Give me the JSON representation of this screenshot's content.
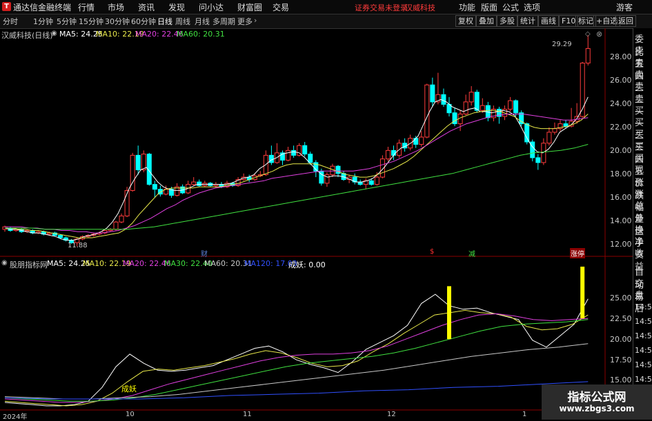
{
  "titlebar": {
    "app_title": "通达信金融终端",
    "menus": [
      "行情",
      "市场",
      "资讯",
      "发现",
      "问小达",
      "财富圈",
      "交易"
    ],
    "login_status": "证券交易未登录",
    "stock": "汉威科技",
    "right_menus": [
      "功能",
      "版面",
      "公式",
      "选项"
    ],
    "guest": "游客"
  },
  "toolbar": {
    "periods": [
      "分时",
      "1分钟",
      "5分钟",
      "15分钟",
      "30分钟",
      "60分钟",
      "日线",
      "周线",
      "月线",
      "多周期",
      "更多"
    ],
    "active_period": "日线",
    "buttons": [
      "复权",
      "叠加",
      "多股",
      "统计",
      "画线",
      "F10",
      "标记",
      "+自选",
      "返回"
    ]
  },
  "main_chart": {
    "stock_label": "汉威科技(日线)",
    "ma_labels": [
      {
        "text": "MA5: 24.25",
        "color": "#ffffff"
      },
      {
        "text": "MA10: 22.19",
        "color": "#e8e84a"
      },
      {
        "text": "MA20: 22.46",
        "color": "#e040e0"
      },
      {
        "text": "MA60: 20.31",
        "color": "#40e040"
      }
    ],
    "y_ticks": [
      "28.00",
      "26.00",
      "24.00",
      "22.00",
      "20.00",
      "18.00",
      "16.00",
      "14.00",
      "12.00"
    ],
    "y_range": [
      11.3,
      29.7
    ],
    "high_annotation": "29.29",
    "low_annotation": "11.88",
    "events": [
      {
        "label": "财",
        "color": "#5a7fd8"
      },
      {
        "label": "$",
        "color": "#ff3030"
      },
      {
        "label": "减",
        "color": "#40e040"
      },
      {
        "label": "涨停",
        "color": "#ffffff"
      }
    ]
  },
  "indicator": {
    "name": "股朋指标网",
    "labels": [
      {
        "text": "MA5: 24.25",
        "color": "#ffffff"
      },
      {
        "text": "MA10: 22.19",
        "color": "#e8e84a"
      },
      {
        "text": "MA20: 22.46",
        "color": "#e040e0"
      },
      {
        "text": "MA30: 22.40",
        "color": "#40e040"
      },
      {
        "text": "MA60: 20.31",
        "color": "#c8c8c8"
      },
      {
        "text": "MA120: 17.03",
        "color": "#3050ff"
      },
      {
        "text": "成妖: 0.00",
        "color": "#ffffff"
      }
    ],
    "y_ticks": [
      "25.00",
      "22.50",
      "20.00",
      "17.50",
      "15.00"
    ],
    "y_range": [
      14.6,
      26.4
    ],
    "signal_label": "成妖"
  },
  "x_dates": [
    "2024年",
    "10",
    "11",
    "12",
    "1"
  ],
  "side_panel": {
    "items_main": [
      "委比",
      "卖五",
      "卖四",
      "卖三",
      "卖二",
      "卖一",
      "买一",
      "买二",
      "买三",
      "买四",
      "买五",
      "现价",
      "涨跌",
      "涨幅",
      "总量",
      "外盘",
      "换手",
      "净资",
      "收益"
    ],
    "items_lower": [
      "自动",
      "交易",
      "盘后"
    ],
    "times": [
      "14:50",
      "14:50",
      "14:56",
      "14:56",
      "14:57",
      "14:57",
      "14:57"
    ]
  },
  "watermark": {
    "line1": "指标公式网",
    "line2": "www.zbgs3.com"
  },
  "colors": {
    "up": "#ff3c3c",
    "down": "#00ffff",
    "ma60": "#40e040",
    "ma120": "#3050ff",
    "signal": "#ffff00"
  },
  "chart_data": {
    "type": "candlestick",
    "title": "汉威科技(日线)",
    "ylim": [
      11.3,
      29.7
    ],
    "candles": [
      [
        13.3,
        13.5,
        13.6,
        13.1
      ],
      [
        13.4,
        13.2,
        13.5,
        13.1
      ],
      [
        13.2,
        13.3,
        13.4,
        13.1
      ],
      [
        13.3,
        13.1,
        13.4,
        13.0
      ],
      [
        13.1,
        13.2,
        13.3,
        13.0
      ],
      [
        13.2,
        13.0,
        13.3,
        12.9
      ],
      [
        13.0,
        13.1,
        13.2,
        12.9
      ],
      [
        13.1,
        12.9,
        13.2,
        12.8
      ],
      [
        12.9,
        13.0,
        13.1,
        12.8
      ],
      [
        13.0,
        12.8,
        13.1,
        12.7
      ],
      [
        12.8,
        12.6,
        12.9,
        12.5
      ],
      [
        12.6,
        12.4,
        12.7,
        12.3
      ],
      [
        12.4,
        12.2,
        12.5,
        12.1
      ],
      [
        12.2,
        12.5,
        12.6,
        11.9
      ],
      [
        12.5,
        12.7,
        12.8,
        12.4
      ],
      [
        12.7,
        12.8,
        12.9,
        12.6
      ],
      [
        12.8,
        12.9,
        13.0,
        12.7
      ],
      [
        12.9,
        13.0,
        13.1,
        12.8
      ],
      [
        13.0,
        13.2,
        13.3,
        12.9
      ],
      [
        13.2,
        13.3,
        13.4,
        13.1
      ],
      [
        13.3,
        13.9,
        14.0,
        13.2
      ],
      [
        13.9,
        14.4,
        14.6,
        13.8
      ],
      [
        14.4,
        16.5,
        16.8,
        14.3
      ],
      [
        16.5,
        19.4,
        19.6,
        16.4
      ],
      [
        19.4,
        18.2,
        20.2,
        17.8
      ],
      [
        18.2,
        19.5,
        19.8,
        18.0
      ],
      [
        19.5,
        17.0,
        19.6,
        16.9
      ],
      [
        17.0,
        16.6,
        17.3,
        15.9
      ],
      [
        16.6,
        16.2,
        16.9,
        16.0
      ],
      [
        16.2,
        16.6,
        16.9,
        16.1
      ],
      [
        16.6,
        16.1,
        16.8,
        15.9
      ],
      [
        16.1,
        16.8,
        17.1,
        16.0
      ],
      [
        16.8,
        16.3,
        17.0,
        16.2
      ],
      [
        16.3,
        17.0,
        17.3,
        16.2
      ],
      [
        17.0,
        17.2,
        17.6,
        16.9
      ],
      [
        17.2,
        16.9,
        17.4,
        16.8
      ],
      [
        16.9,
        17.1,
        17.3,
        16.8
      ],
      [
        17.1,
        16.9,
        17.2,
        16.8
      ],
      [
        16.9,
        17.0,
        17.2,
        16.7
      ],
      [
        17.0,
        16.8,
        17.2,
        16.7
      ],
      [
        16.8,
        17.1,
        17.3,
        16.7
      ],
      [
        17.1,
        16.9,
        17.2,
        16.8
      ],
      [
        16.9,
        17.4,
        17.6,
        16.8
      ],
      [
        17.4,
        17.6,
        17.9,
        17.3
      ],
      [
        17.6,
        17.4,
        17.8,
        17.2
      ],
      [
        17.4,
        17.7,
        17.9,
        17.3
      ],
      [
        17.7,
        17.8,
        18.1,
        17.6
      ],
      [
        17.8,
        19.4,
        19.8,
        17.7
      ],
      [
        19.4,
        18.8,
        20.2,
        18.6
      ],
      [
        18.8,
        19.6,
        20.4,
        18.7
      ],
      [
        19.6,
        19.0,
        19.8,
        18.6
      ],
      [
        19.0,
        19.8,
        20.1,
        18.9
      ],
      [
        19.8,
        19.4,
        20.2,
        19.2
      ],
      [
        19.4,
        20.2,
        20.4,
        19.3
      ],
      [
        20.2,
        19.5,
        20.5,
        19.3
      ],
      [
        19.5,
        18.8,
        19.7,
        18.6
      ],
      [
        18.8,
        18.1,
        19.0,
        17.6
      ],
      [
        18.1,
        17.1,
        18.3,
        16.9
      ],
      [
        17.1,
        17.8,
        18.0,
        16.8
      ],
      [
        17.8,
        18.5,
        18.7,
        17.6
      ],
      [
        18.5,
        17.9,
        18.6,
        17.6
      ],
      [
        17.9,
        17.4,
        18.1,
        17.3
      ],
      [
        17.4,
        17.6,
        17.8,
        17.1
      ],
      [
        17.6,
        17.2,
        17.9,
        17.0
      ],
      [
        17.2,
        17.0,
        17.4,
        16.9
      ],
      [
        17.0,
        17.3,
        17.5,
        16.6
      ],
      [
        17.3,
        17.0,
        17.5,
        16.9
      ],
      [
        17.0,
        17.6,
        18.0,
        16.9
      ],
      [
        17.6,
        19.1,
        19.4,
        17.5
      ],
      [
        19.1,
        19.8,
        20.1,
        18.9
      ],
      [
        19.8,
        19.4,
        20.2,
        19.0
      ],
      [
        19.4,
        20.4,
        20.7,
        19.2
      ],
      [
        20.4,
        20.0,
        20.8,
        19.7
      ],
      [
        20.0,
        20.8,
        21.1,
        19.8
      ],
      [
        20.8,
        20.3,
        21.0,
        20.0
      ],
      [
        20.3,
        20.9,
        21.4,
        20.1
      ],
      [
        20.9,
        25.2,
        25.3,
        20.8
      ],
      [
        25.2,
        23.8,
        25.8,
        23.4
      ],
      [
        23.8,
        24.4,
        26.2,
        23.6
      ],
      [
        24.4,
        23.6,
        24.9,
        23.4
      ],
      [
        23.6,
        22.9,
        24.2,
        22.6
      ],
      [
        22.9,
        22.0,
        23.3,
        21.8
      ],
      [
        22.0,
        22.8,
        23.1,
        21.4
      ],
      [
        22.8,
        23.8,
        24.4,
        22.7
      ],
      [
        23.8,
        24.6,
        25.1,
        23.5
      ],
      [
        24.6,
        23.1,
        24.8,
        22.9
      ],
      [
        23.1,
        23.5,
        24.1,
        22.9
      ],
      [
        23.5,
        22.5,
        23.8,
        22.2
      ],
      [
        22.5,
        23.2,
        23.5,
        22.2
      ],
      [
        23.2,
        22.6,
        23.4,
        22.0
      ],
      [
        22.6,
        23.2,
        23.5,
        22.3
      ],
      [
        23.2,
        23.9,
        24.2,
        23.0
      ],
      [
        23.9,
        22.9,
        24.0,
        22.6
      ],
      [
        22.9,
        22.0,
        23.1,
        21.8
      ],
      [
        22.0,
        20.5,
        22.1,
        20.3
      ],
      [
        20.5,
        19.2,
        20.7,
        18.9
      ],
      [
        19.2,
        18.8,
        19.5,
        18.2
      ],
      [
        18.8,
        20.4,
        20.8,
        18.6
      ],
      [
        20.4,
        21.3,
        21.7,
        20.2
      ],
      [
        21.3,
        21.6,
        22.1,
        21.1
      ],
      [
        21.6,
        22.0,
        22.3,
        21.4
      ],
      [
        22.0,
        21.8,
        22.3,
        21.6
      ],
      [
        21.8,
        22.2,
        23.3,
        21.7
      ],
      [
        22.2,
        22.6,
        23.7,
        22.0
      ],
      [
        22.6,
        27.0,
        27.1,
        22.5
      ],
      [
        27.0,
        28.2,
        29.3,
        26.8
      ]
    ],
    "ma_series": [
      {
        "name": "MA5",
        "color": "#ffffff",
        "values": [
          13.4,
          13.3,
          13.3,
          13.2,
          13.1,
          13.0,
          13.0,
          12.9,
          12.8,
          12.7,
          12.5,
          12.4,
          12.4,
          12.5,
          12.7,
          12.8,
          12.9,
          13.1,
          13.4,
          13.9,
          14.6,
          15.6,
          16.7,
          17.5,
          18.2,
          18.4,
          17.8,
          17.2,
          16.8,
          16.6,
          16.5,
          16.5,
          16.6,
          16.8,
          17.0,
          17.0,
          17.0,
          17.0,
          17.0,
          17.0,
          17.1,
          17.3,
          17.5,
          17.6,
          17.8,
          18.3,
          18.6,
          19.0,
          19.2,
          19.5,
          19.6,
          19.7,
          19.6,
          19.2,
          18.7,
          18.2,
          17.8,
          17.6,
          17.7,
          17.7,
          17.6,
          17.4,
          17.2,
          17.2,
          17.3,
          17.5,
          17.9,
          18.4,
          19.0,
          19.6,
          20.0,
          20.2,
          20.5,
          21.0,
          22.0,
          23.0,
          23.8,
          24.0,
          23.8,
          23.4,
          23.2,
          23.0,
          23.2,
          23.3,
          23.0,
          23.0,
          22.9,
          23.0,
          23.1,
          23.0,
          22.7,
          21.9,
          21.0,
          20.2,
          19.7,
          19.6,
          19.9,
          20.5,
          21.3,
          21.6,
          21.9,
          22.4,
          23.2,
          24.2
        ]
      },
      {
        "name": "MA10",
        "color": "#e8e84a",
        "values": [
          13.4,
          13.4,
          13.3,
          13.3,
          13.2,
          13.2,
          13.1,
          13.0,
          12.9,
          12.8,
          12.7,
          12.6,
          12.6,
          12.6,
          12.7,
          12.8,
          12.9,
          13.0,
          13.3,
          13.8,
          14.5,
          15.1,
          15.7,
          16.3,
          16.6,
          16.7,
          16.7,
          16.7,
          16.7,
          16.8,
          16.8,
          16.8,
          16.8,
          16.9,
          17.0,
          17.1,
          17.3,
          17.5,
          17.7,
          17.9,
          18.1,
          18.4,
          18.6,
          18.7,
          18.7,
          18.7,
          18.7,
          18.6,
          18.4,
          18.2,
          18.0,
          17.8,
          17.7,
          17.6,
          17.6,
          17.7,
          17.9,
          18.1,
          18.3,
          18.6,
          18.9,
          19.3,
          19.8,
          20.3,
          20.8,
          21.3,
          21.8,
          22.2,
          22.5,
          22.7,
          22.9,
          23.0,
          23.1,
          23.1,
          23.0,
          22.8,
          22.6,
          22.2,
          21.9,
          21.7,
          21.6,
          21.6,
          21.6,
          21.7,
          21.8,
          22.0,
          22.3,
          22.8
        ]
      },
      {
        "name": "MA20",
        "color": "#e040e0",
        "values": [
          13.5,
          13.5,
          13.5,
          13.4,
          13.4,
          13.3,
          13.3,
          13.2,
          13.2,
          13.1,
          13.1,
          13.0,
          13.0,
          13.1,
          13.2,
          13.4,
          13.6,
          13.9,
          14.2,
          14.6,
          15.0,
          15.3,
          15.7,
          16.0,
          16.3,
          16.5,
          16.7,
          16.8,
          16.9,
          17.0,
          17.1,
          17.2,
          17.3,
          17.5,
          17.6,
          17.7,
          17.8,
          17.9,
          18.0,
          18.1,
          18.1,
          18.1,
          18.1,
          18.1,
          18.2,
          18.3,
          18.5,
          18.7,
          18.9,
          19.2,
          19.5,
          19.8,
          20.2,
          20.6,
          21.0,
          21.4,
          21.7,
          22.0,
          22.2,
          22.4,
          22.6,
          22.7,
          22.8,
          22.8,
          22.8,
          22.7,
          22.6,
          22.5,
          22.4,
          22.3,
          22.3,
          22.4,
          22.5
        ]
      },
      {
        "name": "MA60",
        "color": "#40e040",
        "values": [
          13.4,
          13.4,
          13.4,
          13.3,
          13.3,
          13.3,
          13.3,
          13.3,
          13.3,
          13.3,
          13.4,
          13.5,
          13.7,
          13.9,
          14.1,
          14.3,
          14.5,
          14.7,
          14.9,
          15.1,
          15.3,
          15.5,
          15.7,
          15.9,
          16.1,
          16.3,
          16.5,
          16.7,
          16.9,
          17.1,
          17.3,
          17.5,
          17.7,
          17.9,
          18.2,
          18.5,
          18.8,
          19.1,
          19.4,
          19.6,
          19.7,
          19.8,
          20.0,
          20.3
        ]
      }
    ],
    "indicator_series": [
      {
        "name": "MA5",
        "color": "#ffffff",
        "values": [
          15.2,
          15.1,
          15.0,
          14.9,
          14.9,
          15.0,
          15.3,
          16.5,
          18.3,
          19.4,
          18.6,
          18.0,
          17.9,
          18.0,
          18.2,
          18.4,
          18.9,
          19.4,
          19.9,
          20.1,
          19.6,
          18.9,
          18.5,
          18.2,
          17.8,
          18.7,
          19.8,
          20.4,
          21.0,
          21.9,
          23.8,
          24.6,
          23.6,
          23.3,
          23.4,
          23.0,
          22.7,
          22.4,
          20.6,
          20.0,
          21.0,
          22.0,
          24.2
        ]
      },
      {
        "name": "MA10",
        "color": "#e8e84a",
        "values": [
          15.3,
          15.2,
          15.1,
          15.0,
          14.9,
          15.0,
          15.3,
          16.0,
          17.0,
          17.9,
          18.1,
          18.0,
          18.2,
          18.4,
          18.7,
          19.0,
          19.4,
          19.7,
          19.5,
          19.1,
          18.6,
          18.3,
          18.4,
          18.8,
          19.6,
          20.3,
          21.2,
          22.0,
          22.8,
          23.0,
          23.2,
          23.0,
          22.9,
          22.6,
          21.8,
          21.5,
          21.6,
          22.0,
          22.8
        ]
      },
      {
        "name": "MA20",
        "color": "#e040e0",
        "values": [
          15.5,
          15.4,
          15.3,
          15.2,
          15.2,
          15.3,
          15.5,
          15.8,
          16.3,
          16.8,
          17.2,
          17.6,
          18.0,
          18.4,
          18.8,
          19.1,
          19.3,
          19.4,
          19.4,
          19.5,
          19.7,
          20.1,
          20.7,
          21.3,
          21.9,
          22.4,
          22.8,
          22.9,
          22.7,
          22.4,
          22.3,
          22.4,
          22.5
        ]
      },
      {
        "name": "MA30",
        "color": "#40e040",
        "values": [
          15.6,
          15.5,
          15.4,
          15.3,
          15.3,
          15.4,
          15.6,
          15.9,
          16.3,
          16.7,
          17.1,
          17.5,
          17.9,
          18.3,
          18.6,
          18.8,
          19.0,
          19.2,
          19.5,
          19.9,
          20.4,
          20.9,
          21.4,
          21.8,
          22.0,
          22.1,
          22.2,
          22.4
        ]
      },
      {
        "name": "MA60",
        "color": "#c8c8c8",
        "values": [
          15.7,
          15.6,
          15.5,
          15.5,
          15.6,
          15.7,
          15.9,
          16.2,
          16.5,
          16.8,
          17.1,
          17.4,
          17.7,
          18.0,
          18.4,
          18.8,
          19.2,
          19.5,
          19.8,
          20.0,
          20.3
        ]
      },
      {
        "name": "MA120",
        "color": "#3050ff",
        "values": [
          15.6,
          15.5,
          15.5,
          15.5,
          15.6,
          15.8,
          15.9,
          16.0,
          16.2,
          16.3,
          16.5,
          16.6,
          16.8,
          17.0
        ]
      }
    ],
    "signals": [
      {
        "index": 80,
        "low": 20.7,
        "high": 25.3
      },
      {
        "index": 104,
        "low": 22.5,
        "high": 27.0
      }
    ]
  }
}
